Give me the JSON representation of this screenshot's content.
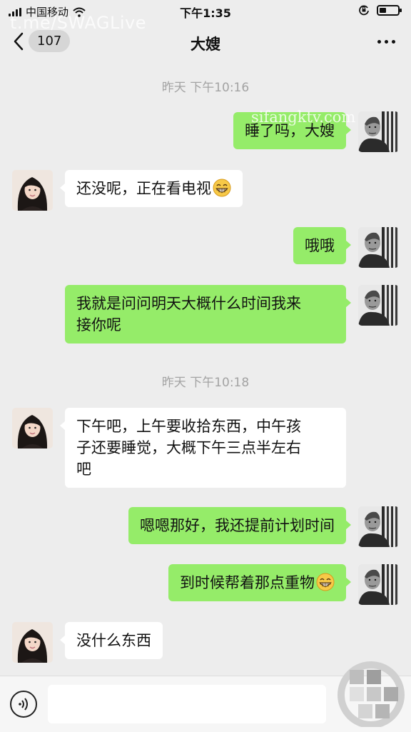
{
  "status_bar": {
    "carrier": "中国移动",
    "time": "下午1:35"
  },
  "watermarks": {
    "top": "t.me/SWAGLive",
    "middle": "sifangktv.com"
  },
  "nav": {
    "unread_count": "107",
    "title": "大嫂"
  },
  "chat": {
    "timestamps": [
      "昨天 下午10:16",
      "昨天 下午10:18"
    ],
    "messages": [
      {
        "side": "out",
        "text": "睡了吗，大嫂"
      },
      {
        "side": "in",
        "text": "还没呢，正在看电视",
        "emoji": "grin-emoji"
      },
      {
        "side": "out",
        "text": "哦哦"
      },
      {
        "side": "out",
        "line1": "我就是问问明天大概什么时间我来",
        "line2": "接你呢"
      },
      {
        "side": "in",
        "line1": "下午吧，上午要收拾东西，中午孩",
        "line2": "子还要睡觉，大概下午三点半左右",
        "line3": "吧"
      },
      {
        "side": "out",
        "text": "嗯嗯那好，我还提前计划时间"
      },
      {
        "side": "out",
        "text": "到时候帮着那点重物",
        "emoji": "grin-emoji"
      },
      {
        "side": "in",
        "text": "没什么东西"
      }
    ]
  },
  "input_bar": {
    "placeholder": ""
  },
  "colors": {
    "outgoing_bubble": "#95ec69",
    "incoming_bubble": "#ffffff",
    "background": "#ededed"
  },
  "icons": {
    "back": "chevron-left-icon",
    "more": "more-dots-icon",
    "voice": "voice-icon",
    "emoji": "grin-emoji-icon"
  }
}
